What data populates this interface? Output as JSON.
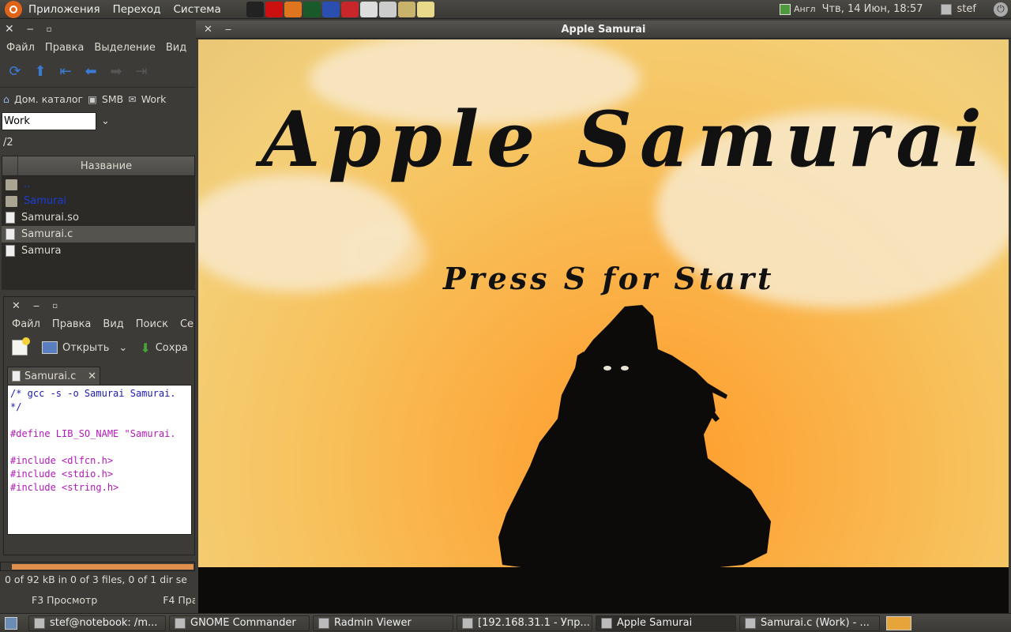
{
  "top_panel": {
    "menus": [
      "Приложения",
      "Переход",
      "Система"
    ],
    "launchers": [
      {
        "icon": "terminal-icon",
        "color": "#222222"
      },
      {
        "icon": "opera-icon",
        "color": "#cc1010"
      },
      {
        "icon": "firefox-icon",
        "color": "#e0751f"
      },
      {
        "icon": "terminal2-icon",
        "color": "#1a5a2a"
      },
      {
        "icon": "save-icon",
        "color": "#2a4fb0"
      },
      {
        "icon": "download-icon",
        "color": "#c8262a"
      },
      {
        "icon": "document-icon",
        "color": "#dddddd"
      },
      {
        "icon": "browser-icon",
        "color": "#cccccc"
      },
      {
        "icon": "bank-icon",
        "color": "#c9b26a"
      },
      {
        "icon": "printer-icon",
        "color": "#e9d98a"
      }
    ],
    "keyboard_layout": "Англ",
    "clock": "Чтв, 14 Июн, 18:57",
    "user": "stef"
  },
  "file_manager": {
    "menu": [
      "Файл",
      "Правка",
      "Выделение",
      "Вид"
    ],
    "bookmarks": [
      "Дом. каталог",
      "SMB",
      "Work"
    ],
    "path_input": "Work",
    "current_path": "/2",
    "column": "Название",
    "files": [
      {
        "name": "..",
        "type": "folder",
        "blue": true
      },
      {
        "name": "Samurai",
        "type": "folder",
        "blue": true
      },
      {
        "name": "Samurai.so",
        "type": "file",
        "blue": false
      },
      {
        "name": "Samurai.c",
        "type": "file",
        "blue": false,
        "selected": true
      },
      {
        "name": "Samura",
        "type": "file",
        "blue": false
      }
    ],
    "status": "0  of 92  kB in 0 of 3 files, 0 of 1 dir se",
    "fkeys": [
      "F3 Просмотр",
      "F4 Пра"
    ]
  },
  "gedit": {
    "menu": [
      "Файл",
      "Правка",
      "Вид",
      "Поиск",
      "Се"
    ],
    "toolbar_open": "Открыть",
    "toolbar_save": "Сохра",
    "tab_name": "Samurai.c",
    "code": [
      "/* gcc -s -o Samurai Samurai.",
      "*/",
      "",
      "#define LIB_SO_NAME \"Samurai.",
      "",
      "#include <dlfcn.h>",
      "#include <stdio.h>",
      "#include <string.h>",
      "",
      "",
      "",
      "/*"
    ]
  },
  "game": {
    "window_title": "Apple Samurai",
    "title_text": "Apple Samurai",
    "subtitle_text": "Press S for Start"
  },
  "taskbar": {
    "tasks": [
      {
        "label": "stef@notebook: /m...",
        "active": false
      },
      {
        "label": "GNOME Commander",
        "active": false
      },
      {
        "label": "Radmin Viewer",
        "active": false
      },
      {
        "label": "[192.168.31.1 - Упр...",
        "active": false
      },
      {
        "label": "Apple Samurai",
        "active": true
      },
      {
        "label": "Samurai.c (Work) - ...",
        "active": false
      }
    ]
  }
}
